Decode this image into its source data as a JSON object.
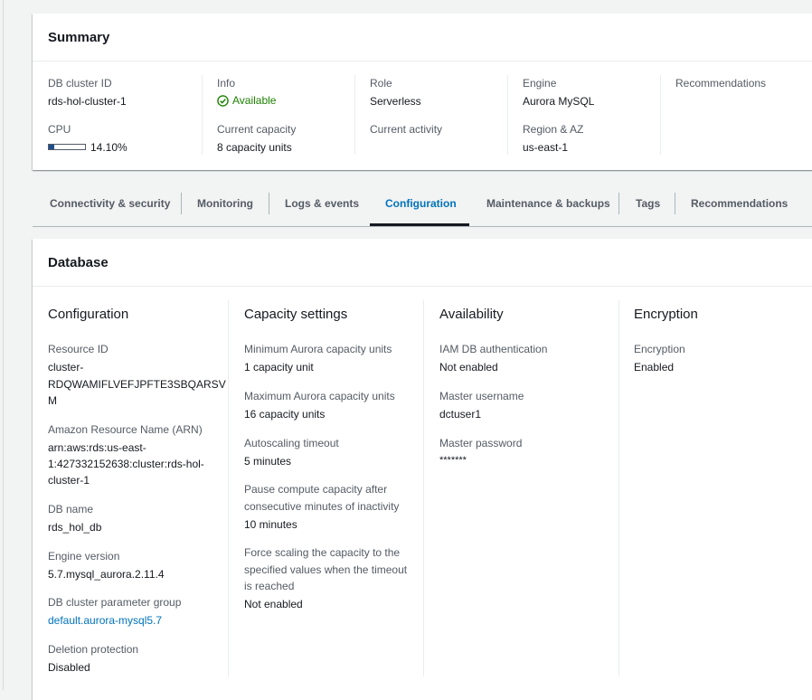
{
  "summary": {
    "title": "Summary",
    "db_cluster_id": {
      "label": "DB cluster ID",
      "value": "rds-hol-cluster-1"
    },
    "cpu": {
      "label": "CPU",
      "value": "14.10%",
      "fraction": 0.141
    },
    "info": {
      "label": "Info",
      "value": "Available",
      "icon": "check-circle-icon",
      "color": "#1d8102"
    },
    "current_capacity": {
      "label": "Current capacity",
      "value": "8 capacity units"
    },
    "role": {
      "label": "Role",
      "value": "Serverless"
    },
    "current_activity": {
      "label": "Current activity",
      "value": ""
    },
    "engine": {
      "label": "Engine",
      "value": "Aurora MySQL"
    },
    "region": {
      "label": "Region & AZ",
      "value": "us-east-1"
    },
    "recommendations": {
      "label": "Recommendations",
      "value": ""
    }
  },
  "tabs": [
    {
      "label": "Connectivity & security"
    },
    {
      "label": "Monitoring"
    },
    {
      "label": "Logs & events"
    },
    {
      "label": "Configuration",
      "active": true
    },
    {
      "label": "Maintenance & backups"
    },
    {
      "label": "Tags"
    },
    {
      "label": "Recommendations"
    }
  ],
  "database": {
    "title": "Database",
    "configuration": {
      "title": "Configuration",
      "resource_id": {
        "label": "Resource ID",
        "value_line1": "cluster-",
        "value_line2": "RDQWAMIFLVEFJPFTE3SBQARSV",
        "value_line3": "M"
      },
      "arn": {
        "label": "Amazon Resource Name (ARN)",
        "value_line1": "arn:aws:rds:us-east-",
        "value_line2": "1:427332152638:cluster:rds-hol-",
        "value_line3": "cluster-1"
      },
      "db_name": {
        "label": "DB name",
        "value": "rds_hol_db"
      },
      "engine_version": {
        "label": "Engine version",
        "value": "5.7.mysql_aurora.2.11.4"
      },
      "param_group": {
        "label": "DB cluster parameter group",
        "value": "default.aurora-mysql5.7"
      },
      "deletion_protection": {
        "label": "Deletion protection",
        "value": "Disabled"
      }
    },
    "capacity": {
      "title": "Capacity settings",
      "min_acu": {
        "label": "Minimum Aurora capacity units",
        "value": "1 capacity unit"
      },
      "max_acu": {
        "label": "Maximum Aurora capacity units",
        "value": "16 capacity units"
      },
      "autoscaling_timeout": {
        "label": "Autoscaling timeout",
        "value": "5 minutes"
      },
      "pause": {
        "label_line1": "Pause compute capacity after",
        "label_line2": "consecutive minutes of inactivity",
        "value": "10 minutes"
      },
      "force_scaling": {
        "label_line1": "Force scaling the capacity to the",
        "label_line2": "specified values when the timeout",
        "label_line3": "is reached",
        "value": "Not enabled"
      }
    },
    "availability": {
      "title": "Availability",
      "iam_auth": {
        "label": "IAM DB authentication",
        "value": "Not enabled"
      },
      "master_username": {
        "label": "Master username",
        "value": "dctuser1"
      },
      "master_password": {
        "label": "Master password",
        "value": "*******"
      }
    },
    "encryption": {
      "title": "Encryption",
      "encryption": {
        "label": "Encryption",
        "value": "Enabled"
      }
    }
  }
}
